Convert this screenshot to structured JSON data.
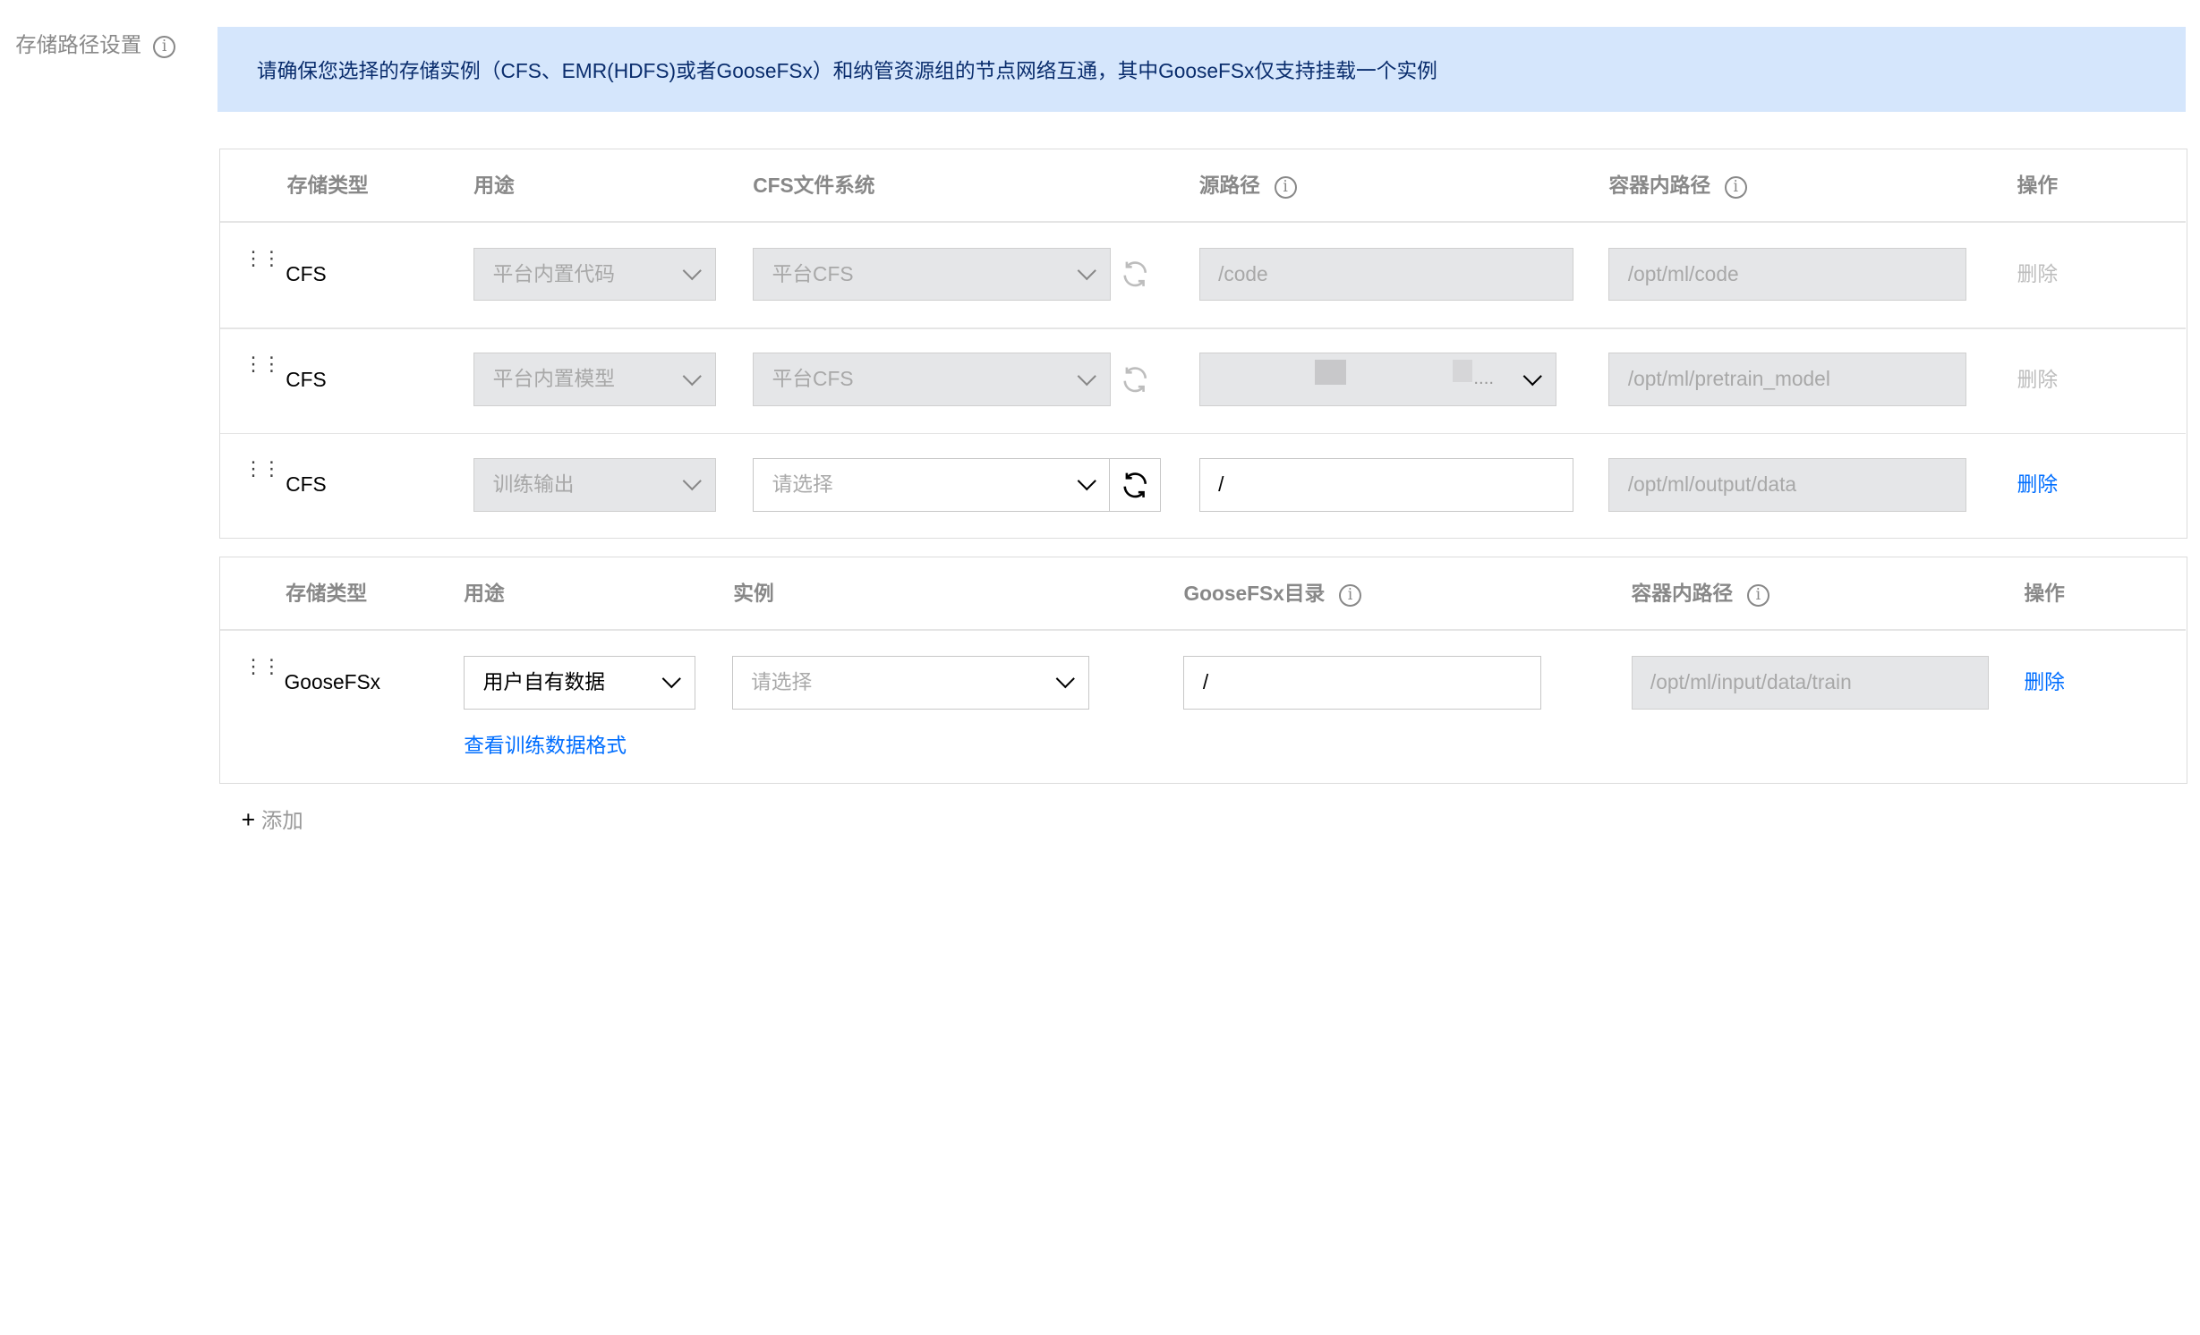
{
  "section": {
    "label": "存储路径设置"
  },
  "banner": {
    "text": "请确保您选择的存储实例（CFS、EMR(HDFS)或者GooseFSx）和纳管资源组的节点网络互通，其中GooseFSx仅支持挂载一个实例"
  },
  "cfs_table": {
    "headers": {
      "type": "存储类型",
      "usage": "用途",
      "fs": "CFS文件系统",
      "source": "源路径",
      "container": "容器内路径",
      "action": "操作"
    },
    "rows": [
      {
        "type": "CFS",
        "usage": "平台内置代码",
        "fs": "平台CFS",
        "source": "/code",
        "container": "/opt/ml/code",
        "action": "删除"
      },
      {
        "type": "CFS",
        "usage": "平台内置模型",
        "fs": "平台CFS",
        "source": "....",
        "container": "/opt/ml/pretrain_model",
        "action": "删除"
      },
      {
        "type": "CFS",
        "usage": "训练输出",
        "fs_placeholder": "请选择",
        "source": "/",
        "container": "/opt/ml/output/data",
        "action": "删除"
      }
    ]
  },
  "goose_table": {
    "headers": {
      "type": "存储类型",
      "usage": "用途",
      "instance": "实例",
      "dir": "GooseFSx目录",
      "container": "容器内路径",
      "action": "操作"
    },
    "row": {
      "type": "GooseFSx",
      "usage": "用户自有数据",
      "instance_placeholder": "请选择",
      "dir": "/",
      "container": "/opt/ml/input/data/train",
      "action": "删除",
      "link": "查看训练数据格式"
    }
  },
  "add": {
    "label": "添加"
  },
  "colors": {
    "accent": "#006eff",
    "banner_bg": "#d5e6fc",
    "disabled_bg": "#e5e6e8"
  },
  "icons": {
    "info": "info-icon",
    "refresh": "refresh-icon",
    "chevron": "chevron-down-icon",
    "drag": "drag-handle-icon",
    "plus": "plus-icon"
  }
}
